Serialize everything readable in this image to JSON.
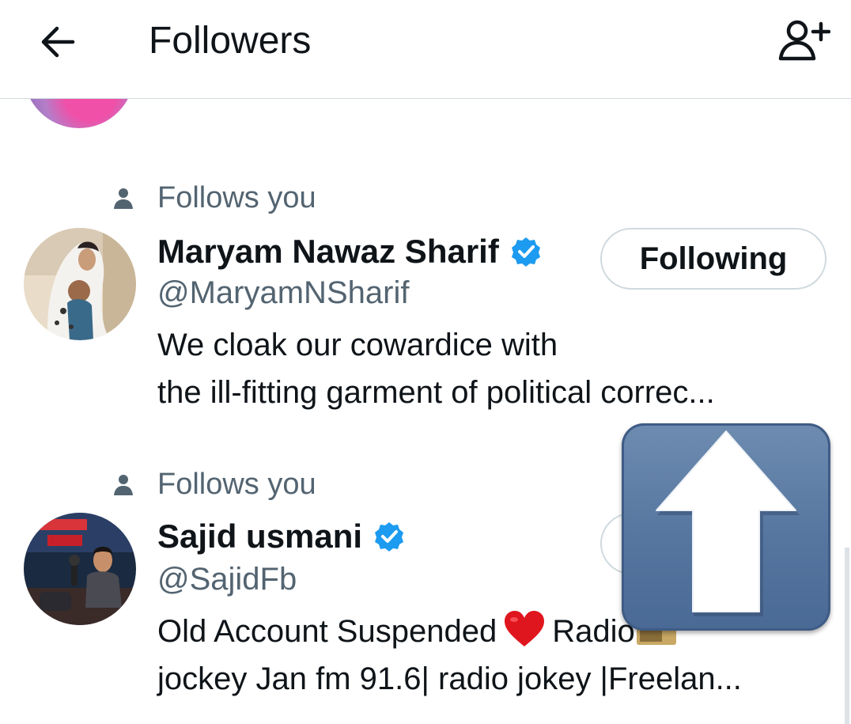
{
  "header": {
    "title": "Followers"
  },
  "followers": [
    {
      "follows_you_label": "Follows you",
      "name": "Maryam Nawaz Sharif",
      "verified": true,
      "handle": "@MaryamNSharif",
      "bio_line1": "We cloak our cowardice with",
      "bio_line2": "the ill-fitting garment of political correc...",
      "button_label": "Following"
    },
    {
      "follows_you_label": "Follows you",
      "name": "Sajid usmani",
      "verified": true,
      "handle": "@SajidFb",
      "bio_line1_a": "Old Account Suspended",
      "bio_line1_b": "Radio",
      "bio_line2": "jockey Jan fm 91.6| radio jokey |Freelan..."
    }
  ],
  "icons": {
    "back": "arrow-left-icon",
    "add_user": "person-add-icon",
    "follows_you": "person-icon",
    "verified": "verified-badge-icon",
    "heart": "red-heart-emoji",
    "radio": "radio-emoji",
    "overlay": "upload-arrow-icon"
  },
  "colors": {
    "text_primary": "#0f1419",
    "text_secondary": "#536471",
    "verified_blue": "#1d9bf0",
    "border": "#cfd9de",
    "overlay_blue": "#5676a0"
  }
}
